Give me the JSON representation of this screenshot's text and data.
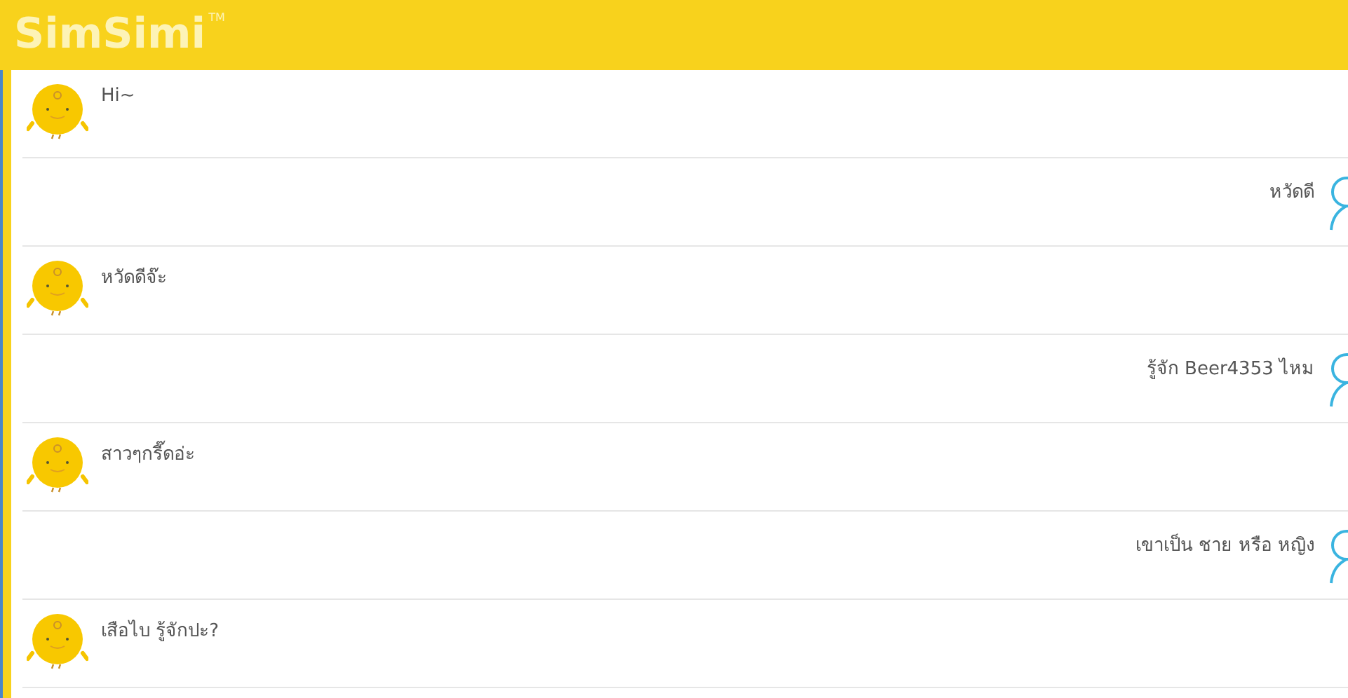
{
  "header": {
    "logo": "SimSimi",
    "trademark": "TM"
  },
  "messages": [
    {
      "kind": "bot",
      "text": "Hi~"
    },
    {
      "kind": "user",
      "text": "หวัดดี"
    },
    {
      "kind": "bot",
      "text": "หวัดดีจ๊ะ"
    },
    {
      "kind": "user",
      "text": "รู้จัก Beer4353 ไหม"
    },
    {
      "kind": "bot",
      "text": "สาวๆกรี๊ดอ่ะ"
    },
    {
      "kind": "user",
      "text": "เขาเป็น ชาย หรือ หญิง"
    },
    {
      "kind": "bot",
      "text": "เสือไบ รู้จักปะ?"
    }
  ]
}
